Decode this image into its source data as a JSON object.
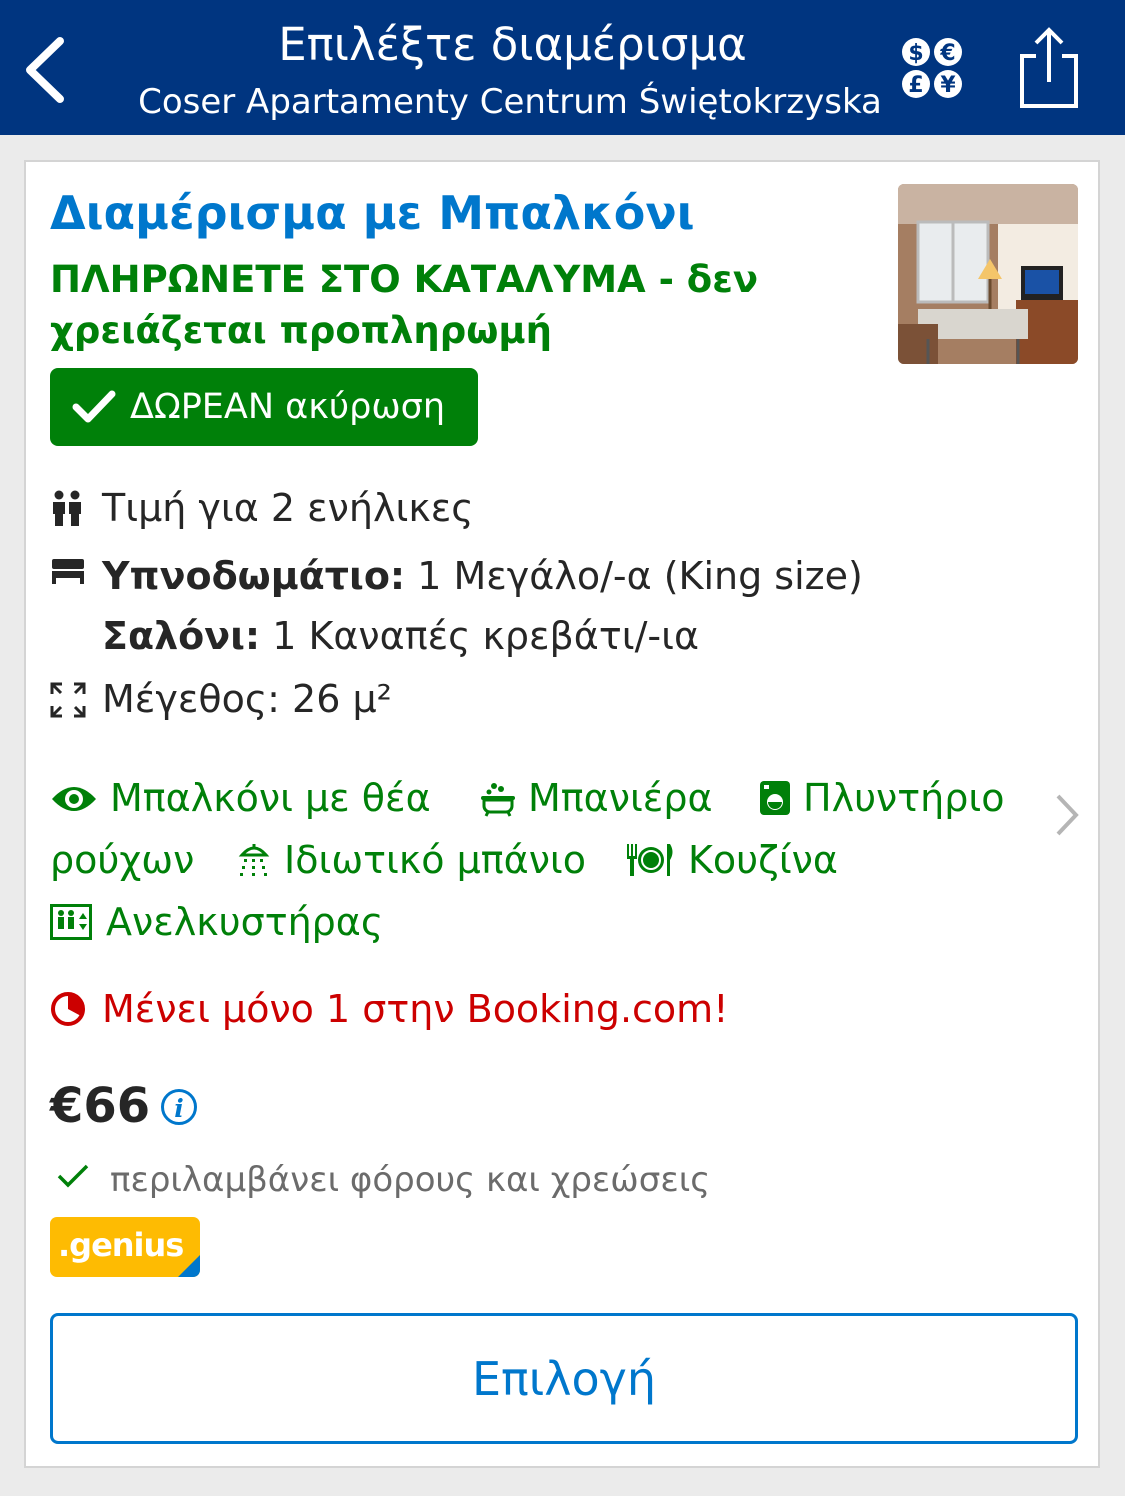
{
  "header": {
    "title": "Επιλέξτε διαμέρισμα",
    "subtitle": "Coser Apartamenty Centrum Świętokrzyska",
    "back_icon": "chevron-left-icon",
    "currency_icon": "currency-icon",
    "share_icon": "share-icon",
    "background_color": "#003580"
  },
  "room": {
    "name": "Διαμέρισμα με Μπαλκόνι",
    "pay_note": "ΠΛΗΡΩΝΕΤΕ ΣΤΟ ΚΑΤΑΛΥΜΑ - δεν χρειάζεται προπληρωμή",
    "free_cancellation": "ΔΩΡΕΑΝ ακύρωση",
    "occupancy": "Τιμή για 2 ενήλικες",
    "beds": [
      {
        "room": "Υπνοδωμάτιο:",
        "bed": " 1 Μεγάλο/-α (King size)"
      },
      {
        "room": "Σαλόνι:",
        "bed": " 1 Καναπές κρεβάτι/-ια"
      }
    ],
    "size": "Μέγεθος: 26 μ²"
  },
  "facilities": {
    "balcony_view": "Μπαλκόνι με θέα",
    "bathtub": "Μπανιέρα",
    "washing_machine_1": "Πλυντήριο",
    "washing_machine_2": "ρούχων",
    "private_bathroom": "Ιδιωτικό μπάνιο",
    "kitchen": "Κουζίνα",
    "elevator": "Ανελκυστήρας"
  },
  "availability": {
    "scarcity": "Μένει μόνο 1 στην Booking.com!"
  },
  "pricing": {
    "price": "€66",
    "tax_note": "περιλαμβάνει φόρους και χρεώσεις",
    "genius_label": ".genius"
  },
  "actions": {
    "select_label": "Επιλογή"
  },
  "colors": {
    "accent": "#0077cc",
    "green": "#008009",
    "red": "#cc0000",
    "genius_yellow": "#febb02"
  }
}
